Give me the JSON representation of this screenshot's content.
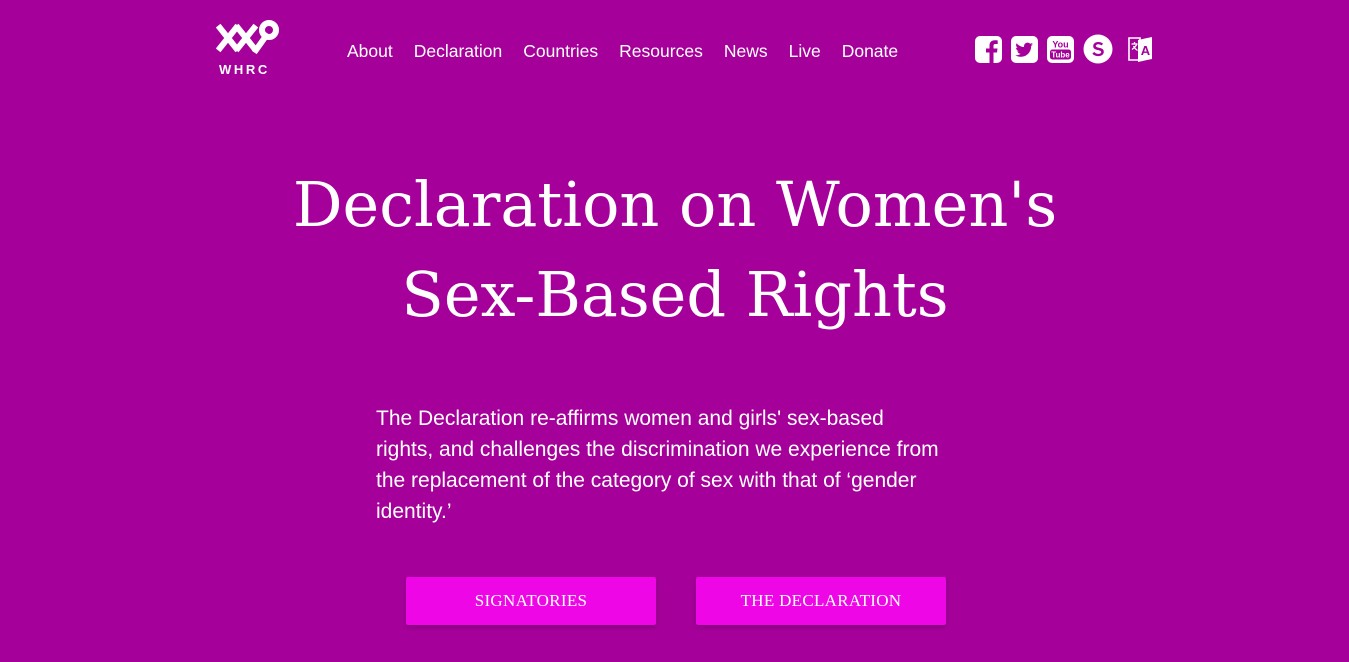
{
  "brand": {
    "logo_text": "WHRC",
    "logo_icon": "whrc-logo-icon"
  },
  "nav": {
    "items": [
      {
        "label": "About"
      },
      {
        "label": "Declaration"
      },
      {
        "label": "Countries"
      },
      {
        "label": "Resources"
      },
      {
        "label": "News"
      },
      {
        "label": "Live"
      },
      {
        "label": "Donate"
      }
    ]
  },
  "social": {
    "icons": [
      "facebook-icon",
      "twitter-icon",
      "youtube-icon",
      "substack-icon",
      "translate-icon"
    ],
    "youtube_text_top": "You",
    "youtube_text_bottom": "Tube",
    "translate_letter": "A"
  },
  "hero": {
    "title_line1": "Declaration on Women's",
    "title_line2": "Sex-Based Rights",
    "description": "The Declaration re-affirms women and girls' sex-based rights, and challenges the discrimination we experience from the replacement of the category of sex with that of ‘gender identity.’"
  },
  "buttons": {
    "signatories": "SIGNATORIES",
    "declaration": "THE DECLARATION"
  },
  "colors": {
    "background": "#a5009a",
    "button": "#ee06e6",
    "text": "#ffffff"
  }
}
